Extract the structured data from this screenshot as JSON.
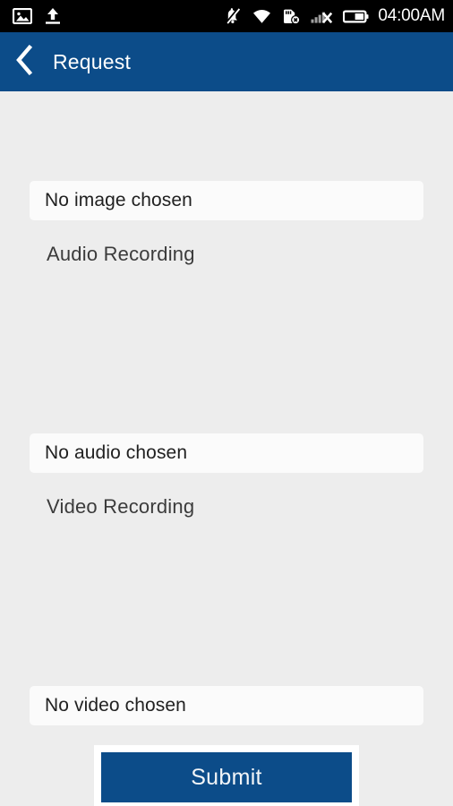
{
  "statusbar": {
    "time": "04:00AM",
    "left_icons": [
      {
        "name": "image-icon",
        "label": "image"
      },
      {
        "name": "upload-icon",
        "label": "upload"
      }
    ],
    "right_icons": [
      {
        "name": "notifications-off-icon",
        "label": "notifications off"
      },
      {
        "name": "wifi-icon",
        "label": "wifi"
      },
      {
        "name": "sd-card-removed-icon",
        "label": "sd card removed"
      },
      {
        "name": "signal-no-service-icon",
        "label": "no signal"
      },
      {
        "name": "battery-icon",
        "label": "battery"
      }
    ]
  },
  "appbar": {
    "back_label": "back",
    "title": "Request",
    "background": "#0c4c89"
  },
  "form": {
    "image_chosen_text": "No image chosen",
    "audio_section_label": "Audio Recording",
    "audio_chosen_text": "No audio chosen",
    "video_section_label": "Video Recording",
    "video_chosen_text": "No video chosen",
    "submit_label": "Submit"
  },
  "colors": {
    "accent": "#0c4c89",
    "page_background": "#ededed",
    "field_background": "#fbfbfb",
    "statusbar_background": "#000000"
  }
}
